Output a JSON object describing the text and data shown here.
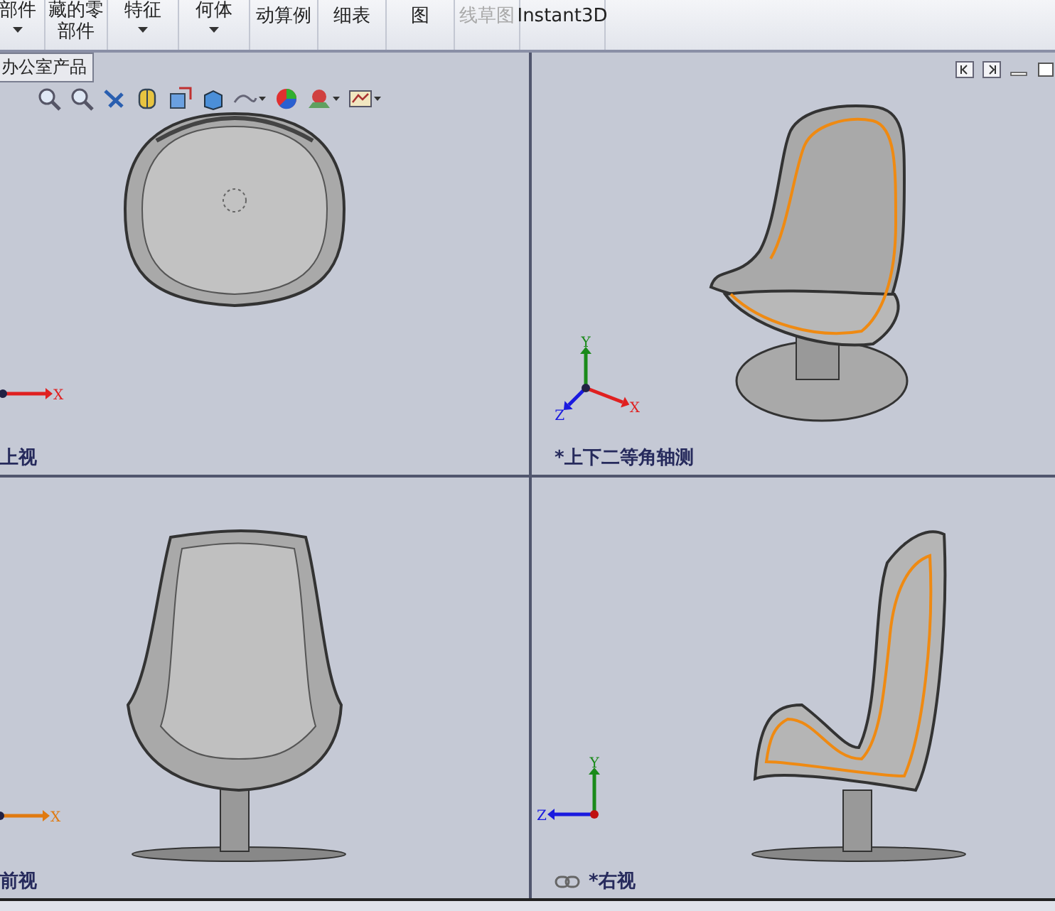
{
  "toolbar": {
    "buttons": [
      {
        "lines": [
          "部件"
        ],
        "dropdown": true,
        "disabled": false
      },
      {
        "lines": [
          "藏的零",
          "部件"
        ],
        "dropdown": false,
        "disabled": false
      },
      {
        "lines": [
          "特征"
        ],
        "dropdown": true,
        "disabled": false
      },
      {
        "lines": [
          "何体"
        ],
        "dropdown": true,
        "disabled": false
      },
      {
        "lines": [
          "动算例"
        ],
        "dropdown": false,
        "disabled": false
      },
      {
        "lines": [
          "细表"
        ],
        "dropdown": false,
        "disabled": false
      },
      {
        "lines": [
          "图"
        ],
        "dropdown": false,
        "disabled": false
      },
      {
        "lines": [
          "线草图"
        ],
        "dropdown": false,
        "disabled": true
      },
      {
        "lines": [
          "Instant3D"
        ],
        "dropdown": false,
        "disabled": false
      }
    ]
  },
  "document_tab": {
    "label": "办公室产品"
  },
  "viewports": [
    {
      "kind": "top",
      "label": "上视",
      "linked": false,
      "triad": [
        {
          "kind": "x",
          "label": "X"
        }
      ]
    },
    {
      "kind": "iso",
      "label": "*上下二等角轴测",
      "linked": false,
      "triad": [
        {
          "kind": "y",
          "label": "Y"
        },
        {
          "kind": "x",
          "label": "X"
        },
        {
          "kind": "z",
          "label": "Z"
        }
      ]
    },
    {
      "kind": "front",
      "label": "前视",
      "linked": false,
      "triad": [
        {
          "kind": "x",
          "label": "X"
        }
      ]
    },
    {
      "kind": "right",
      "label": "*右视",
      "linked": true,
      "triad": [
        {
          "kind": "y",
          "label": "Y"
        },
        {
          "kind": "z",
          "label": "Z"
        }
      ]
    }
  ]
}
